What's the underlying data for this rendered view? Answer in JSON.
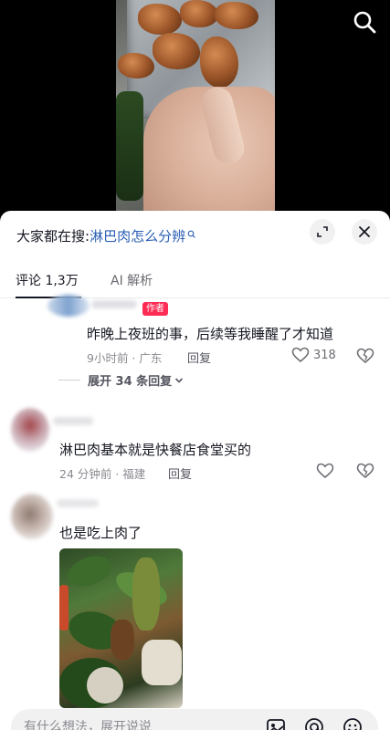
{
  "sheet": {
    "search_prefix": "大家都在搜:",
    "search_query": "淋巴肉怎么分辨"
  },
  "tabs": [
    {
      "label": "评论 1,3万"
    },
    {
      "label": "AI 解析"
    }
  ],
  "comments": [
    {
      "author_tag": "作者",
      "text": "昨晚上夜班的事，后续等我睡醒了才知道",
      "time_location": "9小时前 · 广东",
      "reply_label": "回复",
      "likes": "318",
      "expand_replies": "展开 34 条回复"
    },
    {
      "text": "淋巴肉基本就是快餐店食堂买的",
      "time_location": "24 分钟前 · 福建",
      "reply_label": "回复"
    },
    {
      "text": "也是吃上肉了"
    }
  ],
  "input_bar": {
    "placeholder": "有什么想法，展开说说"
  },
  "icons": [
    "search-icon",
    "expand-icon",
    "close-icon",
    "heart-icon",
    "dislike-heart-icon",
    "chevron-down-icon",
    "image-icon",
    "at-icon",
    "emoji-icon"
  ]
}
